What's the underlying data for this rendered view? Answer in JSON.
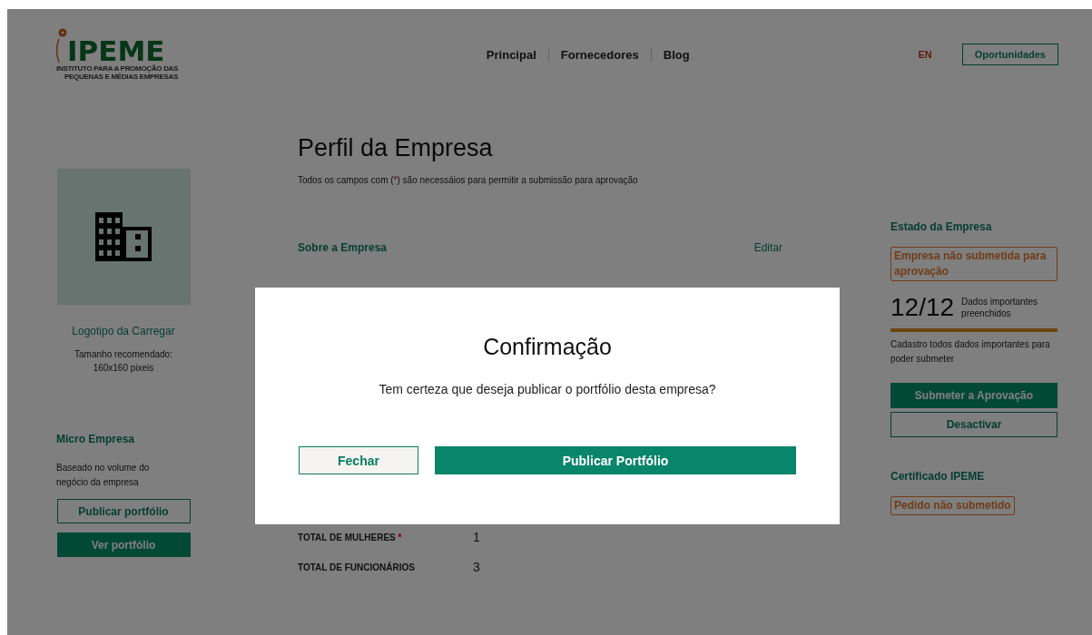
{
  "header": {
    "logo": {
      "name": "IPEME",
      "tagline": [
        "INSTITUTO PARA A PROMOÇÃO DAS",
        "PEQUENAS E MÉDIAS EMPRESAS"
      ]
    },
    "nav": [
      "Principal",
      "Fornecedores",
      "Blog"
    ],
    "language": "EN",
    "cta": "Oportunidades"
  },
  "left": {
    "logo_link": "Logotipo da Carregar",
    "size_hint": [
      "Tamanho recomendado:",
      "160x160 pixeis"
    ],
    "category": "Micro Empresa",
    "category_note": "Baseado no volume do negócio da empresa",
    "buttons": [
      {
        "label": "Publicar portfólio",
        "kind": "outline"
      },
      {
        "label": "Ver portfólio",
        "kind": "solid"
      }
    ]
  },
  "main": {
    "title": "Perfil da Empresa",
    "note": {
      "before": "Todos os campos com (",
      "mark": "*",
      "after": ") são necessáios para permitir a submissão para aprovação"
    },
    "section": {
      "title": "Sobre a Empresa",
      "action": "Editar"
    },
    "fields": [
      {
        "label": "TOTAL DE MULHERES",
        "required": true,
        "value": "1"
      },
      {
        "label": "TOTAL DE FUNCIONÁRIOS",
        "required": false,
        "value": "3"
      }
    ]
  },
  "right": {
    "status_title": "Estado da Empresa",
    "status_badge": "Empresa não submetida para aprovação",
    "progress": {
      "count": "12/12",
      "label": "Dados importantes preenchidos",
      "level": 1
    },
    "hint": "Cadastro todos dados importantes para poder submeter",
    "buttons": [
      {
        "label": "Submeter a Aprovação",
        "kind": "solid"
      },
      {
        "label": "Desactivar",
        "kind": "outline"
      }
    ],
    "cert_title": "Certificado IPEME",
    "cert_badge": "Pedido não submetido"
  },
  "modal": {
    "title": "Confirmação",
    "message": "Tem certeza que deseja publicar o portfólio desta empresa?",
    "buttons": [
      {
        "label": "Fechar",
        "kind": "secondary"
      },
      {
        "label": "Publicar Portfólio",
        "kind": "primary"
      }
    ]
  }
}
